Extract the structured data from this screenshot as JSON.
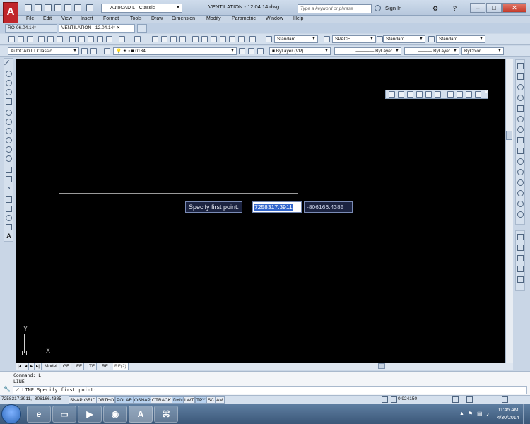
{
  "window": {
    "title": "VENTILATION - 12.04.14.dwg",
    "workspace": "AutoCAD LT Classic",
    "search_placeholder": "Type a keyword or phrase",
    "sign_in": "Sign In"
  },
  "menu": [
    "File",
    "Edit",
    "View",
    "Insert",
    "Format",
    "Tools",
    "Draw",
    "Dimension",
    "Modify",
    "Parametric",
    "Window",
    "Help"
  ],
  "doc_tabs": [
    "RO-06.04.14*",
    "VENTILATION - 12.04.14*"
  ],
  "toolbar": {
    "text_style": "Standard",
    "dim_style": "SPACE",
    "table_style": "Standard",
    "multileader_style": "Standard",
    "workspace_combo": "AutoCAD LT Classic",
    "layer": "0134",
    "color": "ByLayer (VP)",
    "linetype": "ByLayer",
    "lineweight": "ByLayer",
    "plotstyle": "ByColor"
  },
  "dynamic_input": {
    "prompt": "Specify first point:",
    "x_value": "7258317.3911",
    "y_value": "-806166.4385"
  },
  "ucs": {
    "x_label": "X",
    "y_label": "Y"
  },
  "layout_tabs": [
    "Model",
    "GF",
    "FF",
    "TF",
    "RF",
    "RF(2)"
  ],
  "command": {
    "history_1": "Command: L",
    "history_2": "LINE",
    "current": "LINE Specify first point:"
  },
  "status": {
    "coordinates": "7258317.3911, -806166.4385",
    "buttons": [
      "SNAP",
      "GRID",
      "ORTHO",
      "POLAR",
      "OSNAP",
      "OTRACK",
      "DYN",
      "LWT",
      "TPY",
      "SC",
      "AM"
    ],
    "on_buttons": [
      "POLAR",
      "OSNAP",
      "DYN",
      "TPY"
    ],
    "annotation_scale": "0.924150"
  },
  "taskbar": {
    "time": "11:45 AM",
    "date": "4/30/2014"
  }
}
